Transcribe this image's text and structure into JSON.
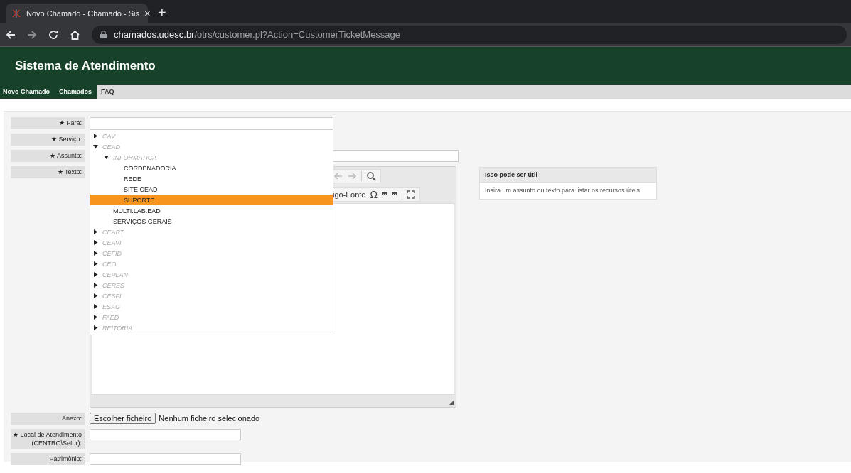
{
  "browser": {
    "tab_title": "Novo Chamado - Chamado - Sis",
    "close": "×",
    "new_tab": "+",
    "url_host": "chamados.udesc.br",
    "url_path": "/otrs/customer.pl?Action=CustomerTicketMessage"
  },
  "header": {
    "title": "Sistema de Atendimento"
  },
  "nav": [
    {
      "label": "Novo Chamado",
      "selected": true
    },
    {
      "label": "Chamados",
      "selected": true
    },
    {
      "label": "FAQ",
      "selected": false
    }
  ],
  "form": {
    "para_label": "★ Para:",
    "servico_label": "★ Serviço:",
    "assunto_label": "★ Assunto:",
    "texto_label": "★ Texto:",
    "editor_toolbar": {
      "source_text": "igo-Fonte",
      "special_char": "Ω",
      "quote_open": "❞❞",
      "quote_close": "❞❞"
    },
    "anexo_label": "Anexo:",
    "file_button": "Escolher ficheiro",
    "file_status": "Nenhum ficheiro selecionado",
    "local_label_line1": "★ Local de Atendimento",
    "local_label_line2": "(CENTRO\\Setor):",
    "patrimonio_label": "Patrimônio:"
  },
  "dropdown": [
    {
      "label": "CAV",
      "kind": "group",
      "expanded": false,
      "selected": false
    },
    {
      "label": "CEAD",
      "kind": "group",
      "expanded": true,
      "selected": false,
      "children": [
        {
          "label": "INFORMATICA",
          "kind": "group",
          "expanded": true,
          "selected": false,
          "children": [
            {
              "label": "CORDENADORIA",
              "kind": "option",
              "selected": false
            },
            {
              "label": "REDE",
              "kind": "option",
              "selected": false
            },
            {
              "label": "SITE CEAD",
              "kind": "option",
              "selected": false
            },
            {
              "label": "SUPORTE",
              "kind": "option",
              "selected": true
            }
          ]
        },
        {
          "label": "MULTI.LAB.EAD",
          "kind": "option",
          "selected": false
        },
        {
          "label": "SERVIÇOS GERAIS",
          "kind": "option",
          "selected": false
        }
      ]
    },
    {
      "label": "CEART",
      "kind": "group",
      "expanded": false,
      "selected": false
    },
    {
      "label": "CEAVI",
      "kind": "group",
      "expanded": false,
      "selected": false
    },
    {
      "label": "CEFID",
      "kind": "group",
      "expanded": false,
      "selected": false
    },
    {
      "label": "CEO",
      "kind": "group",
      "expanded": false,
      "selected": false
    },
    {
      "label": "CEPLAN",
      "kind": "group",
      "expanded": false,
      "selected": false
    },
    {
      "label": "CERES",
      "kind": "group",
      "expanded": false,
      "selected": false
    },
    {
      "label": "CESFI",
      "kind": "group",
      "expanded": false,
      "selected": false
    },
    {
      "label": "ESAG",
      "kind": "group",
      "expanded": false,
      "selected": false
    },
    {
      "label": "FAED",
      "kind": "group",
      "expanded": false,
      "selected": false
    },
    {
      "label": "REITORIA",
      "kind": "group",
      "expanded": false,
      "selected": false
    }
  ],
  "help": {
    "title": "Isso pode ser útil",
    "text": "Insira um assunto ou texto para listar os recursos úteis."
  }
}
